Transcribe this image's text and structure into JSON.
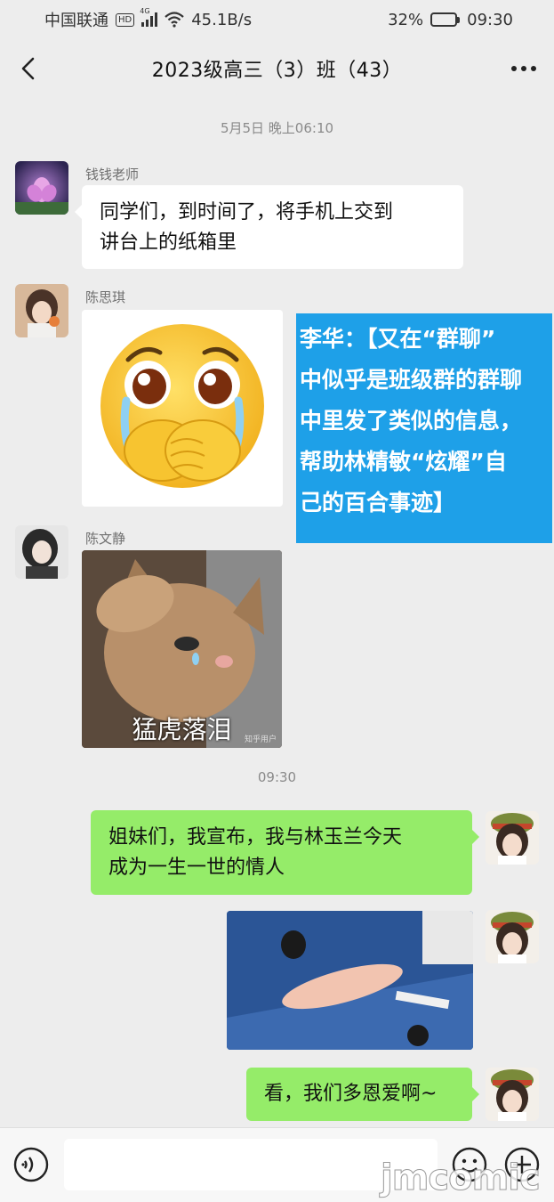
{
  "status_bar": {
    "carrier": "中国联通",
    "hd_badge": "HD",
    "network_badge": "4G",
    "net_speed": "45.1B/s",
    "battery_percent": "32%",
    "battery_level": 0.32,
    "time": "09:30"
  },
  "header": {
    "title": "2023级高三（3）班（43）",
    "back_icon": "chevron-left-icon",
    "more_icon": "more-dots-icon"
  },
  "messages": {
    "timestamp_1": "5月5日 晚上06:10",
    "msg1": {
      "sender": "钱钱老师",
      "line1": "同学们，到时间了，将手机上交到",
      "line2": "讲台上的纸箱里"
    },
    "msg2": {
      "sender": "陈思琪",
      "sticker": "crying-emoji-sticker"
    },
    "msg3": {
      "sender": "陈文静",
      "sticker_caption": "猛虎落泪",
      "sticker_credit": "知乎用户"
    },
    "timestamp_2": "09:30",
    "msg4": {
      "line1": "姐妹们，我宣布，我与林玉兰今天",
      "line2": "成为一生一世的情人"
    },
    "msg5": {
      "type": "image"
    },
    "msg6": {
      "text": "看，我们多恩爱啊~"
    }
  },
  "caption_overlay": {
    "line1": "李华：【又在“群聊”",
    "line2": "中似乎是班级群的群聊",
    "line3": "中里发了类似的信息，",
    "line4": "帮助林精敏“炫耀”自",
    "line5": "己的百合事迹】"
  },
  "input_bar": {
    "placeholder": "",
    "voice_icon": "voice-icon",
    "emoji_icon": "emoji-icon",
    "plus_icon": "plus-icon"
  },
  "watermark": "jmcomic",
  "colors": {
    "background": "#ededed",
    "green_bubble": "#95ec69",
    "caption_blue": "#1ea0e8"
  }
}
